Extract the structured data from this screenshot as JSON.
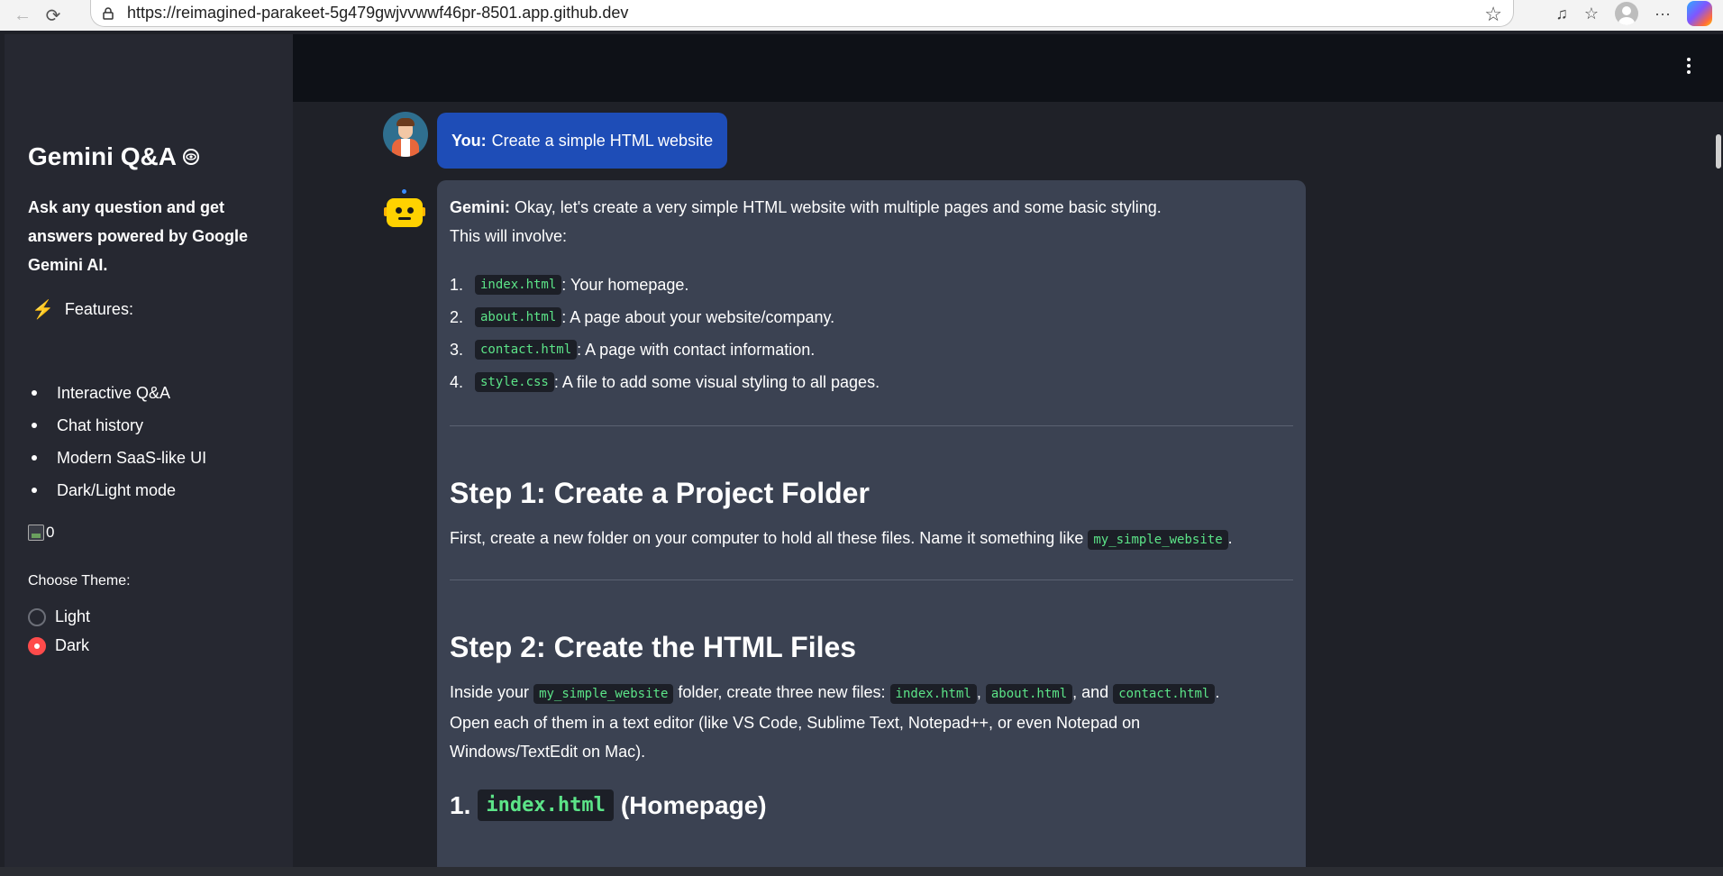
{
  "browser": {
    "url": "https://reimagined-parakeet-5g479gwjvvwwf46pr-8501.app.github.dev"
  },
  "sidebar": {
    "title": "Gemini Q&A",
    "description": "Ask any question and get answers powered by Google Gemini AI.",
    "features_label": "Features:",
    "features": [
      "Interactive Q&A",
      "Chat history",
      "Modern SaaS-like UI",
      "Dark/Light mode"
    ],
    "broken_image_alt": "0",
    "theme_label": "Choose Theme:",
    "theme_options": [
      {
        "label": "Light",
        "selected": false
      },
      {
        "label": "Dark",
        "selected": true
      }
    ]
  },
  "chat": {
    "user_message": {
      "speaker": "You:",
      "text": "Create a simple HTML website"
    },
    "bot_message": {
      "speaker": "Gemini:",
      "intro": "Okay, let's create a very simple HTML website with multiple pages and some basic styling.",
      "intro_line2": "This will involve:",
      "list": [
        {
          "num": "1.",
          "code": "index.html",
          "text": ": Your homepage."
        },
        {
          "num": "2.",
          "code": "about.html",
          "text": ": A page about your website/company."
        },
        {
          "num": "3.",
          "code": "contact.html",
          "text": ": A page with contact information."
        },
        {
          "num": "4.",
          "code": "style.css",
          "text": ": A file to add some visual styling to all pages."
        }
      ],
      "step1": {
        "heading": "Step 1: Create a Project Folder",
        "text_before": "First, create a new folder on your computer to hold all these files. Name it something like",
        "code": "my_simple_website",
        "text_after": "."
      },
      "step2": {
        "heading": "Step 2: Create the HTML Files",
        "t1": "Inside your",
        "c1": "my_simple_website",
        "t2": "folder, create three new files:",
        "c2": "index.html",
        "t3": ",",
        "c3": "about.html",
        "t4": ", and",
        "c4": "contact.html",
        "t5": ".",
        "line2": "Open each of them in a text editor (like VS Code, Sublime Text, Notepad++, or even Notepad on",
        "line3": "Windows/TextEdit on Mac)."
      },
      "sub1": {
        "num": "1.",
        "code": "index.html",
        "text": "(Homepage)"
      }
    }
  },
  "colors": {
    "sidebar_bg": "#262831",
    "main_bg": "#1f2128",
    "user_bubble": "#1e4db7",
    "bot_bubble": "#3b4252",
    "code_text": "#5ce488",
    "radio_selected": "#ff4b4b"
  },
  "icons": [
    "back-arrow-icon",
    "refresh-icon",
    "lock-icon",
    "star-icon",
    "music-icon",
    "favorites-icon",
    "profile-icon",
    "more-icon",
    "copilot-icon",
    "bolt-icon",
    "eye-icon",
    "kebab-menu-icon"
  ]
}
